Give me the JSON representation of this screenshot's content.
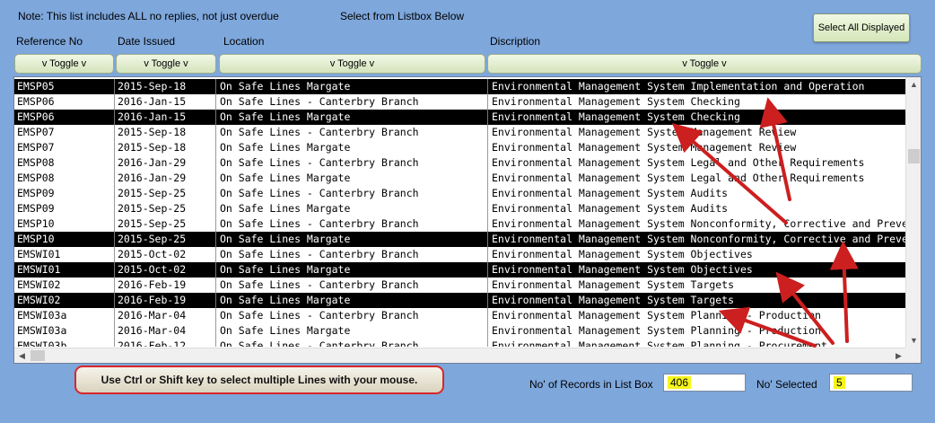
{
  "note": "Note: This list includes ALL no replies, not just overdue",
  "select_hint": "Select from Listbox Below",
  "select_all_label": "Select All Displayed",
  "columns": [
    "Reference No",
    "Date Issued",
    "Location",
    "Discription"
  ],
  "toggle_label": "v Toggle v",
  "rows": [
    {
      "ref": "EMSP05",
      "date": "2015-Sep-18",
      "loc": "On Safe Lines Margate",
      "desc": "Environmental Management System Implementation and Operation",
      "selected": true
    },
    {
      "ref": "EMSP06",
      "date": "2016-Jan-15",
      "loc": "On Safe Lines - Canterbry Branch",
      "desc": "Environmental Management System Checking",
      "selected": false
    },
    {
      "ref": "EMSP06",
      "date": "2016-Jan-15",
      "loc": "On Safe Lines Margate",
      "desc": "Environmental Management System Checking",
      "selected": true
    },
    {
      "ref": "EMSP07",
      "date": "2015-Sep-18",
      "loc": "On Safe Lines - Canterbry Branch",
      "desc": "Environmental Management System Management Review",
      "selected": false
    },
    {
      "ref": "EMSP07",
      "date": "2015-Sep-18",
      "loc": "On Safe Lines Margate",
      "desc": "Environmental Management System Management Review",
      "selected": false
    },
    {
      "ref": "EMSP08",
      "date": "2016-Jan-29",
      "loc": "On Safe Lines - Canterbry Branch",
      "desc": "Environmental Management System Legal and Other Requirements",
      "selected": false
    },
    {
      "ref": "EMSP08",
      "date": "2016-Jan-29",
      "loc": "On Safe Lines Margate",
      "desc": "Environmental Management System Legal and Other Requirements",
      "selected": false
    },
    {
      "ref": "EMSP09",
      "date": "2015-Sep-25",
      "loc": "On Safe Lines - Canterbry Branch",
      "desc": "Environmental Management System Audits",
      "selected": false
    },
    {
      "ref": "EMSP09",
      "date": "2015-Sep-25",
      "loc": "On Safe Lines Margate",
      "desc": "Environmental Management System Audits",
      "selected": false
    },
    {
      "ref": "EMSP10",
      "date": "2015-Sep-25",
      "loc": "On Safe Lines - Canterbry Branch",
      "desc": "Environmental Management System Nonconformity, Corrective and Preventive Ac",
      "selected": false
    },
    {
      "ref": "EMSP10",
      "date": "2015-Sep-25",
      "loc": "On Safe Lines Margate",
      "desc": "Environmental Management System Nonconformity, Corrective and Preventive Ac",
      "selected": true
    },
    {
      "ref": "EMSWI01",
      "date": "2015-Oct-02",
      "loc": "On Safe Lines - Canterbry Branch",
      "desc": "Environmental Management System Objectives",
      "selected": false
    },
    {
      "ref": "EMSWI01",
      "date": "2015-Oct-02",
      "loc": "On Safe Lines Margate",
      "desc": "Environmental Management System Objectives",
      "selected": true
    },
    {
      "ref": "EMSWI02",
      "date": "2016-Feb-19",
      "loc": "On Safe Lines - Canterbry Branch",
      "desc": "Environmental Management System Targets",
      "selected": false
    },
    {
      "ref": "EMSWI02",
      "date": "2016-Feb-19",
      "loc": "On Safe Lines Margate",
      "desc": "Environmental Management System Targets",
      "selected": true
    },
    {
      "ref": "EMSWI03a",
      "date": "2016-Mar-04",
      "loc": "On Safe Lines - Canterbry Branch",
      "desc": "Environmental Management System Planning - Production",
      "selected": false
    },
    {
      "ref": "EMSWI03a",
      "date": "2016-Mar-04",
      "loc": "On Safe Lines Margate",
      "desc": "Environmental Management System Planning - Production",
      "selected": false
    },
    {
      "ref": "EMSWI03b",
      "date": "2016-Feb-12",
      "loc": "On Safe Lines - Canterbry Branch",
      "desc": "Environmental Management System Planning - Procurement",
      "selected": false
    }
  ],
  "callout_text": "Use Ctrl or Shift key to select multiple Lines with your mouse.",
  "records_label": "No' of Records in List Box",
  "records_value": "406",
  "selected_label": "No' Selected",
  "selected_value": "5",
  "colors": {
    "background": "#7ea7dc",
    "selection": "#000000",
    "arrow": "#cc1f1f",
    "highlight": "#f5f51a"
  }
}
